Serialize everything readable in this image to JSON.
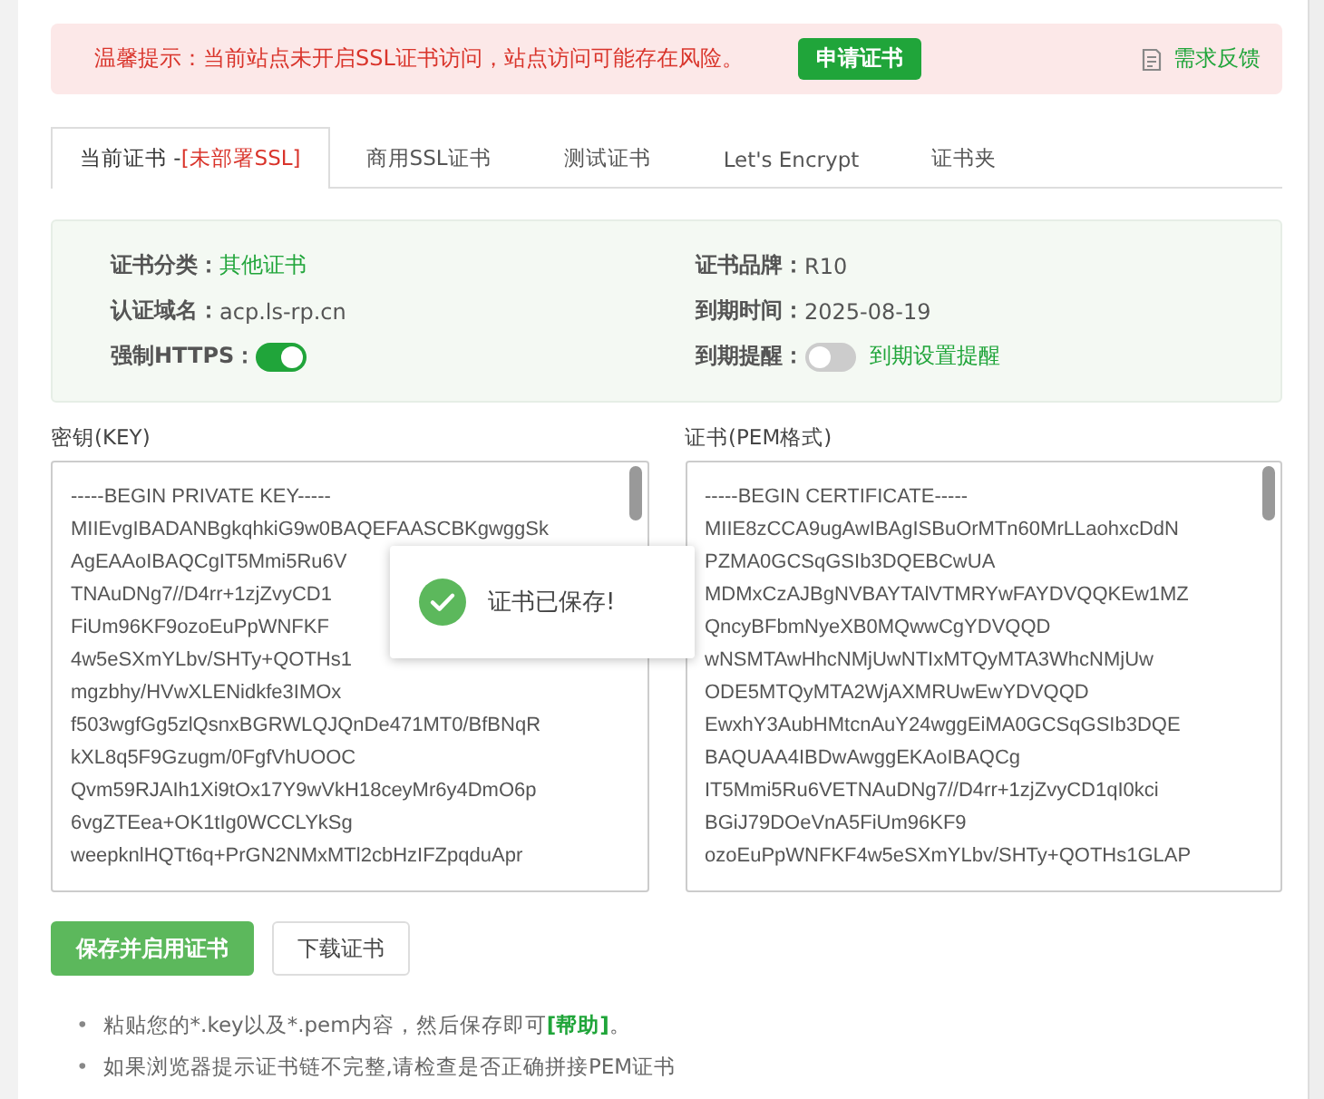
{
  "alert": {
    "message": "温馨提示：当前站点未开启SSL证书访问，站点访问可能存在风险。",
    "apply_button": "申请证书",
    "feedback_link": "需求反馈"
  },
  "tabs": [
    {
      "label": "当前证书 -",
      "status": "[未部署SSL]",
      "selected": true
    },
    {
      "label": "商用SSL证书",
      "selected": false
    },
    {
      "label": "测试证书",
      "selected": false
    },
    {
      "label": "Let's Encrypt",
      "selected": false
    },
    {
      "label": "证书夹",
      "selected": false
    }
  ],
  "info": {
    "left": [
      {
        "kind": "link",
        "label": "证书分类：",
        "value": "其他证书"
      },
      {
        "kind": "text",
        "label": "认证域名：",
        "value": "acp.ls-rp.cn"
      },
      {
        "kind": "switch",
        "label": "强制HTTPS：",
        "on": true
      }
    ],
    "right": [
      {
        "kind": "text",
        "label": "证书品牌：",
        "value": "R10"
      },
      {
        "kind": "text",
        "label": "到期时间：",
        "value": "2025-08-19"
      },
      {
        "kind": "switch",
        "label": "到期提醒：",
        "on": false,
        "link": "到期设置提醒"
      }
    ]
  },
  "key": {
    "label": "密钥(KEY)",
    "lines": [
      "-----BEGIN PRIVATE KEY-----",
      "MIIEvgIBADANBgkqhkiG9w0BAQEFAASCBKgwggSk",
      "AgEAAoIBAQCgIT5Mmi5Ru6V",
      "TNAuDNg7//D4rr+1zjZvyCD1",
      "FiUm96KF9ozoEuPpWNFKF",
      "4w5eSXmYLbv/SHTy+QOTHs1",
      "mgzbhy/HVwXLENidkfe3IMOx",
      "f503wgfGg5zlQsnxBGRWLQJQnDe471MT0/BfBNqR",
      "kXL8q5F9Gzugm/0FgfVhUOOC",
      "Qvm59RJAIh1Xi9tOx17Y9wVkH18ceyMr6y4DmO6p",
      "6vgZTEea+OK1tIg0WCCLYkSg",
      "weepknlHQTt6q+PrGN2NMxMTl2cbHzIFZpqduApr"
    ]
  },
  "cert": {
    "label": "证书(PEM格式)",
    "lines": [
      "-----BEGIN CERTIFICATE-----",
      "MIIE8zCCA9ugAwIBAgISBuOrMTn60MrLLaohxcDdN",
      "PZMA0GCSqGSIb3DQEBCwUA",
      "MDMxCzAJBgNVBAYTAlVTMRYwFAYDVQQKEw1MZ",
      "QncyBFbmNyeXB0MQwwCgYDVQQD",
      "wNSMTAwHhcNMjUwNTIxMTQyMTA3WhcNMjUw",
      "ODE5MTQyMTA2WjAXMRUwEwYDVQQD",
      "EwxhY3AubHMtcnAuY24wggEiMA0GCSqGSIb3DQE",
      "BAQUAA4IBDwAwggEKAoIBAQCg",
      "IT5Mmi5Ru6VETNAuDNg7//D4rr+1zjZvyCD1qI0kci",
      "BGiJ79DOeVnA5FiUm96KF9",
      "ozoEuPpWNFKF4w5eSXmYLbv/SHTy+QOTHs1GLAP"
    ]
  },
  "toast": {
    "message": "证书已保存!"
  },
  "buttons": [
    {
      "kind": "primary",
      "label": "保存并启用证书"
    },
    {
      "kind": "default",
      "label": "下载证书"
    }
  ],
  "notes": [
    {
      "bullet": "•",
      "text": "粘贴您的*.key以及*.pem内容，然后保存即可**[帮助]**。"
    },
    {
      "bullet": "•",
      "text": "如果浏览器提示证书链不完整,请检查是否正确拼接PEM证书"
    }
  ]
}
